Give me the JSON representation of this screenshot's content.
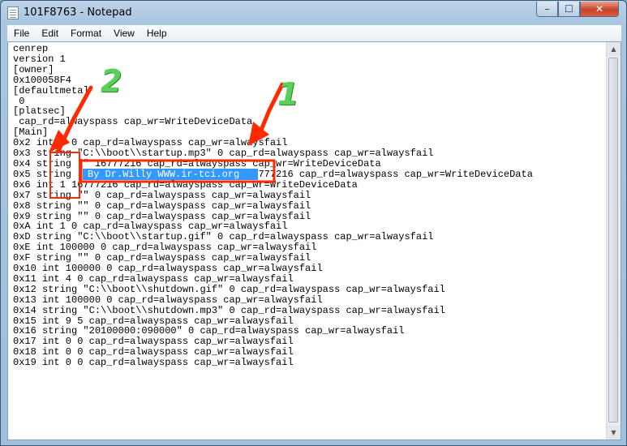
{
  "window": {
    "title": "101F8763 - Notepad",
    "min_glyph": "–",
    "max_glyph": "☐",
    "close_glyph": "✕"
  },
  "menu": [
    "File",
    "Edit",
    "Format",
    "View",
    "Help"
  ],
  "content": {
    "lines": [
      "cenrep",
      "version 1",
      "[owner]",
      "0x100058F4",
      "[defaultmeta]",
      " 0",
      "[platsec]",
      " cap_rd=alwayspass cap_wr=WriteDeviceData",
      "[Main]",
      "0x2 int 0 0 cap_rd=alwayspass cap_wr=alwaysfail",
      "0x3 string \"C:\\\\boot\\\\startup.mp3\" 0 cap_rd=alwayspass cap_wr=alwaysfail",
      "0x4 string \"\" 16777216 cap_rd=alwayspass cap_wr=WriteDeviceData",
      "0x5 string \"By Dr.Willy WWW.ir-tci.org\" 16777216 cap_rd=alwayspass cap_wr=WriteDeviceData",
      "0x6 int 1 16777216 cap_rd=alwayspass cap_wr=WriteDeviceData",
      "0x7 string \"\" 0 cap_rd=alwayspass cap_wr=alwaysfail",
      "0x8 string \"\" 0 cap_rd=alwayspass cap_wr=alwaysfail",
      "0x9 string \"\" 0 cap_rd=alwayspass cap_wr=alwaysfail",
      "0xA int 1 0 cap_rd=alwayspass cap_wr=alwaysfail",
      "0xD string \"C:\\\\boot\\\\startup.gif\" 0 cap_rd=alwayspass cap_wr=alwaysfail",
      "0xE int 100000 0 cap_rd=alwayspass cap_wr=alwaysfail",
      "0xF string \"\" 0 cap_rd=alwayspass cap_wr=alwaysfail",
      "0x10 int 100000 0 cap_rd=alwayspass cap_wr=alwaysfail",
      "0x11 int 4 0 cap_rd=alwayspass cap_wr=alwaysfail",
      "0x12 string \"C:\\\\boot\\\\shutdown.gif\" 0 cap_rd=alwayspass cap_wr=alwaysfail",
      "0x13 int 100000 0 cap_rd=alwayspass cap_wr=alwaysfail",
      "0x14 string \"C:\\\\boot\\\\shutdown.mp3\" 0 cap_rd=alwayspass cap_wr=alwaysfail",
      "0x15 int 9 5 cap_rd=alwayspass cap_wr=alwaysfail",
      "0x16 string \"20100000:090000\" 0 cap_rd=alwayspass cap_wr=alwaysfail",
      "0x17 int 0 0 cap_rd=alwayspass cap_wr=alwaysfail",
      "0x18 int 0 0 cap_rd=alwayspass cap_wr=alwaysfail",
      "0x19 int 0 0 cap_rd=alwayspass cap_wr=alwaysfail"
    ],
    "selected_text": "By Dr.Willy WWW.ir-tci.org"
  },
  "annotations": {
    "label_1": "1",
    "label_2": "2",
    "arrow_color": "#ff2a00",
    "box_color": "#ff2a00",
    "label_color": "#5ad05a"
  },
  "scrollbar": {
    "up_glyph": "▲",
    "down_glyph": "▼"
  }
}
